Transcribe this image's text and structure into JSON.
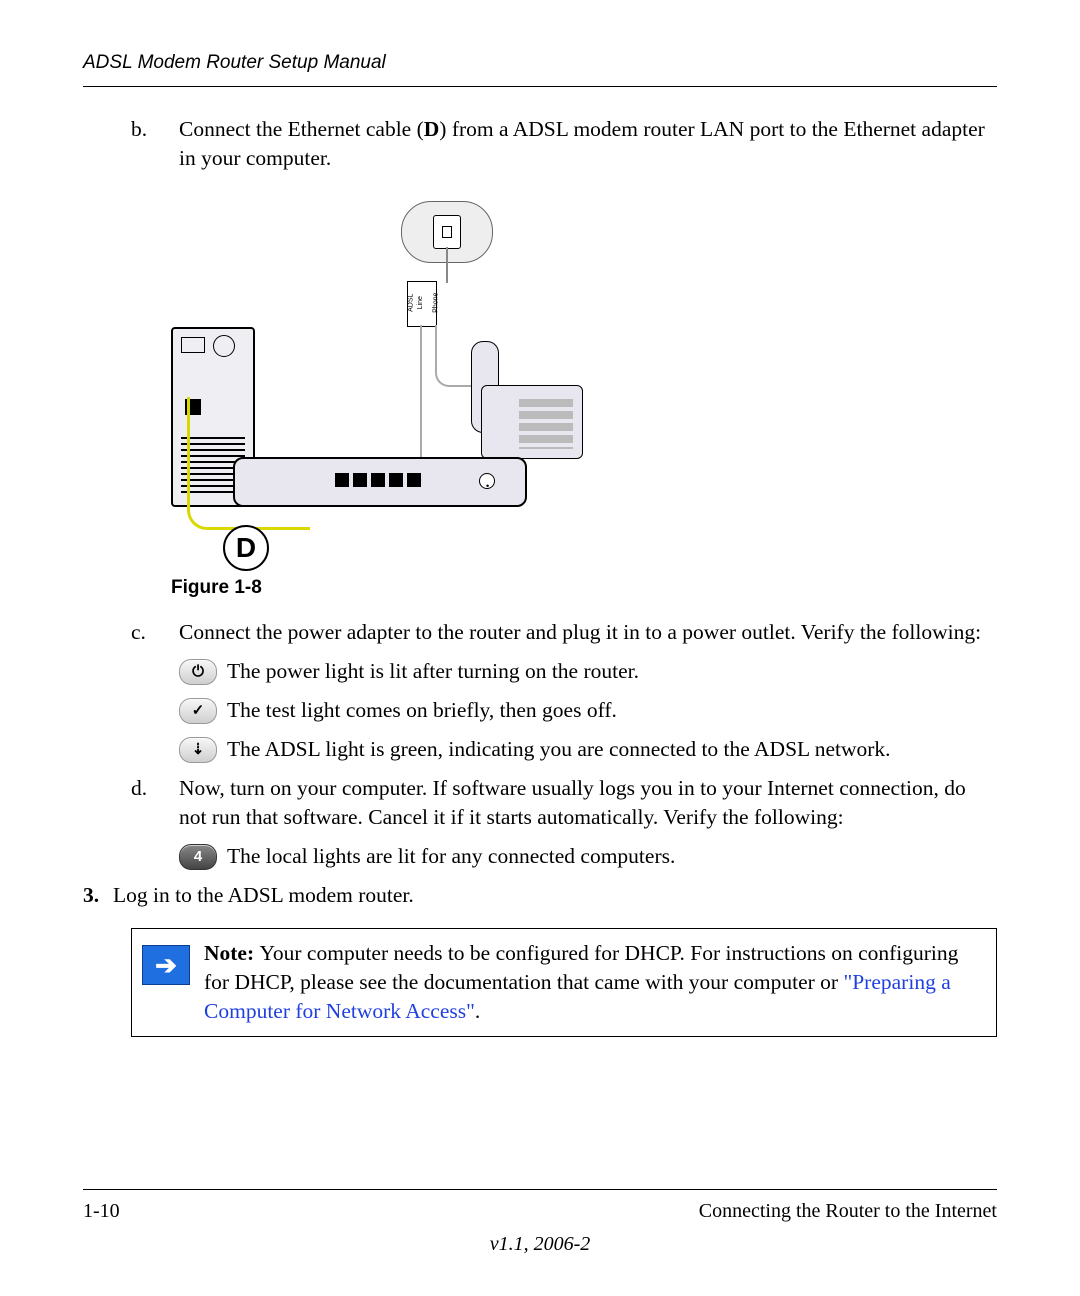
{
  "header": {
    "title": "ADSL Modem Router Setup Manual"
  },
  "steps": {
    "b": {
      "marker": "b.",
      "text_pre": "Connect the Ethernet cable (",
      "bold": "D",
      "text_post": ") from a ADSL modem router LAN port to the Ethernet adapter in your computer."
    },
    "c": {
      "marker": "c.",
      "text": "Connect the power adapter to the router and plug it in to a power outlet. Verify the following:"
    },
    "c_bullets": [
      {
        "icon": "⏻",
        "icon_name": "power-icon",
        "text": "The power light is lit after turning on the router."
      },
      {
        "icon": "✓",
        "icon_name": "check-icon",
        "text": "The test light comes on briefly, then goes off."
      },
      {
        "icon": "⇣",
        "icon_name": "adsl-icon",
        "text": "The ADSL light is green, indicating you are connected to the ADSL network."
      }
    ],
    "d": {
      "marker": "d.",
      "text": "Now, turn on your computer. If software usually logs you in to your Internet connection, do not run that software. Cancel it if it starts automatically. Verify the following:"
    },
    "d_bullets": [
      {
        "icon": "4",
        "icon_name": "port4-icon",
        "dark": true,
        "text": "The local lights are lit for any connected computers."
      }
    ],
    "s3": {
      "marker": "3.",
      "text": "Log in to the ADSL modem router."
    }
  },
  "figure": {
    "caption": "Figure 1-8",
    "label_D": "D",
    "splitter": {
      "adsl": "ADSL",
      "line": "Line",
      "phone": "Phone"
    }
  },
  "note": {
    "label": "Note: ",
    "text1": "Your computer needs to be configured for DHCP. For instructions on configuring for DHCP, please see the documentation that came with your computer or ",
    "link": "\"Preparing a Computer for Network Access\"",
    "text2": "."
  },
  "footer": {
    "page": "1-10",
    "section": "Connecting the Router to the Internet",
    "version": "v1.1, 2006-2"
  }
}
